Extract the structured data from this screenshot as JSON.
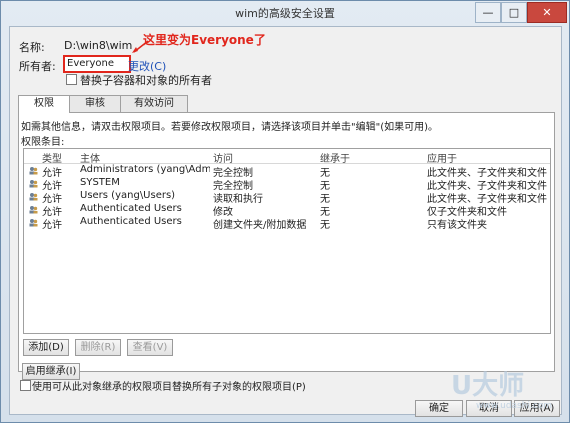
{
  "window": {
    "title": "wim的高级安全设置",
    "min_icon": "minimize-icon",
    "max_icon": "maximize-icon",
    "close_icon": "close-icon",
    "min_glyph": "—",
    "max_glyph": "□",
    "close_glyph": "✕"
  },
  "header": {
    "name_label": "名称:",
    "name_value": "D:\\win8\\wim",
    "owner_label": "所有者:",
    "owner_value": "Everyone",
    "change_link": "更改(C)",
    "replace_owner_checkbox": "替换子容器和对象的所有者",
    "annotation": "这里变为Everyone了"
  },
  "tabs": [
    {
      "label": "权限",
      "active": true
    },
    {
      "label": "审核",
      "active": false
    },
    {
      "label": "有效访问",
      "active": false
    }
  ],
  "panel": {
    "info_text": "如需其他信息，请双击权限项目。若要修改权限项目，请选择该项目并单击\"编辑\"(如果可用)。",
    "entries_label": "权限条目:",
    "columns": [
      "类型",
      "主体",
      "访问",
      "继承于",
      "应用于"
    ],
    "rows": [
      {
        "type": "允许",
        "principal": "Administrators (yang\\Administrat...",
        "access": "完全控制",
        "inherited": "无",
        "applies": "此文件夹、子文件夹和文件"
      },
      {
        "type": "允许",
        "principal": "SYSTEM",
        "access": "完全控制",
        "inherited": "无",
        "applies": "此文件夹、子文件夹和文件"
      },
      {
        "type": "允许",
        "principal": "Users (yang\\Users)",
        "access": "读取和执行",
        "inherited": "无",
        "applies": "此文件夹、子文件夹和文件"
      },
      {
        "type": "允许",
        "principal": "Authenticated Users",
        "access": "修改",
        "inherited": "无",
        "applies": "仅子文件夹和文件"
      },
      {
        "type": "允许",
        "principal": "Authenticated Users",
        "access": "创建文件夹/附加数据",
        "inherited": "无",
        "applies": "只有该文件夹"
      }
    ],
    "add_button": "添加(D)",
    "delete_button": "删除(R)",
    "view_button": "查看(V)"
  },
  "footer": {
    "enable_inheritance_button": "启用继承(I)",
    "replace_child_checkbox": "使用可从此对象继承的权限项目替换所有子对象的权限项目(P)",
    "ok_button": "确定",
    "cancel_button": "取消",
    "apply_button": "应用(A)"
  },
  "watermark": {
    "text": "U大师",
    "url": "www.udashi.com"
  },
  "colors": {
    "annotation": "#e1261c",
    "link": "#2052b8"
  }
}
